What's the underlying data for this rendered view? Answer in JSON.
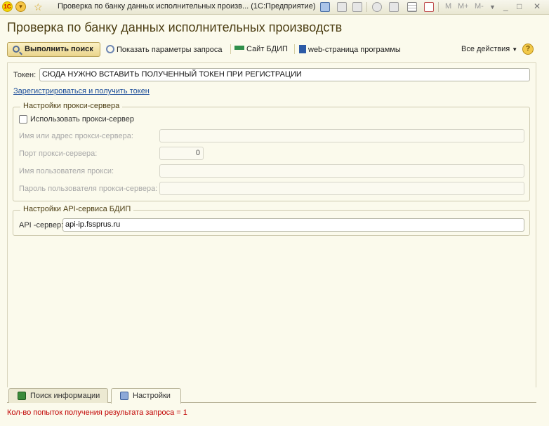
{
  "window": {
    "title": "Проверка по банку данных исполнительных произв...  (1С:Предприятие)",
    "logo_text": "1С",
    "toolbar_m": "M",
    "toolbar_m_plus": "M+",
    "toolbar_m_minus": "M-"
  },
  "form": {
    "title": "Проверка по банку данных исполнительных производств"
  },
  "command_bar": {
    "execute_search": "Выполнить поиск",
    "show_params": "Показать параметры запроса",
    "site_bdip": "Сайт БДИП",
    "web_page": "web-страница программы",
    "all_actions": "Все действия",
    "help_symbol": "?"
  },
  "token": {
    "label": "Токен:",
    "value": "СЮДА НУЖНО ВСТАВИТЬ ПОЛУЧЕННЫЙ ТОКЕН ПРИ РЕГИСТРАЦИИ"
  },
  "register_link": "Зарегистрироваться и получить токен",
  "proxy_group": {
    "title": "Настройки прокси-сервера",
    "use_proxy_label": "Использовать прокси-сервер",
    "use_proxy_checked": false,
    "server_label": "Имя или адрес прокси-сервера:",
    "server_value": "",
    "port_label": "Порт прокси-сервера:",
    "port_value": "0",
    "user_label": "Имя пользователя прокси:",
    "user_value": "",
    "password_label": "Пароль пользователя прокси-сервера:",
    "password_value": ""
  },
  "api_group": {
    "title": "Настройки API-сервиса БДИП",
    "server_label": "API -сервер:",
    "server_value": "api-ip.fssprus.ru"
  },
  "tabs": [
    {
      "label": "Поиск информации",
      "active": false
    },
    {
      "label": "Настройки",
      "active": true
    }
  ],
  "status": {
    "text": "Кол-во попыток получения результата запроса = 1",
    "color": "#c00000"
  },
  "colors": {
    "background": "#fbfaec",
    "title_text": "#4d3f14",
    "link": "#1c4d99"
  }
}
